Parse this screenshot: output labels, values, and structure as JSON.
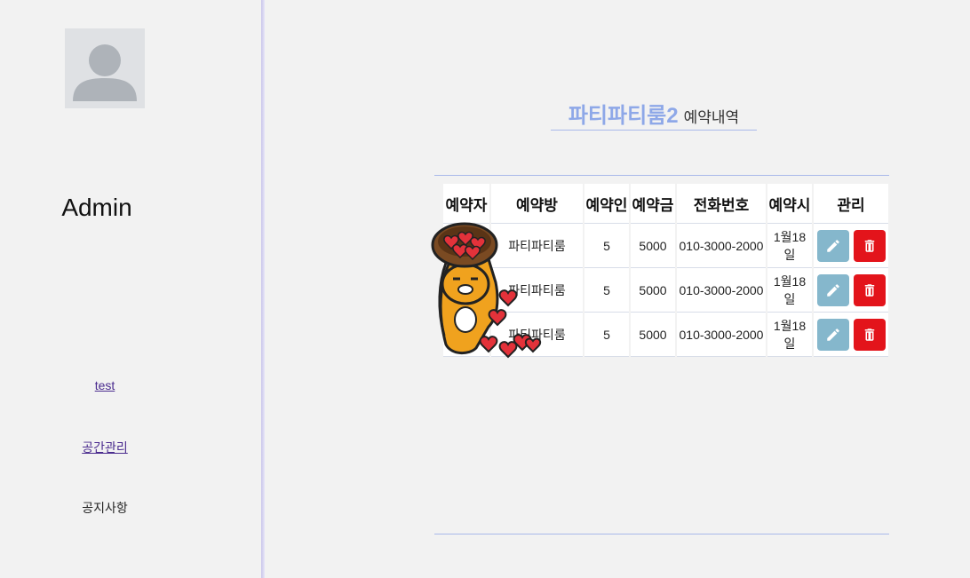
{
  "sidebar": {
    "admin_name": "Admin",
    "links": [
      {
        "label": "test"
      },
      {
        "label": "공간관리"
      },
      {
        "label": "공지사항"
      }
    ]
  },
  "header": {
    "room_name": "파티파티룸2",
    "subtitle": "예약내역"
  },
  "table": {
    "headers": [
      "예약자",
      "예약방",
      "예약인",
      "예약금",
      "전화번호",
      "예약시",
      "관리"
    ],
    "rows": [
      {
        "room": "파티파티룸",
        "people": "5",
        "deposit": "5000",
        "phone": "010-3000-2000",
        "date_line1": "1월18",
        "date_line2": "일"
      },
      {
        "room": "파티파티룸",
        "people": "5",
        "deposit": "5000",
        "phone": "010-3000-2000",
        "date_line1": "1월18",
        "date_line2": "일"
      },
      {
        "room": "파티파티룸",
        "people": "5",
        "deposit": "5000",
        "phone": "010-3000-2000",
        "date_line1": "1월18",
        "date_line2": "일"
      }
    ]
  },
  "icons": {
    "avatar": "user-placeholder-icon",
    "edit": "pencil-icon",
    "delete": "trash-icon"
  },
  "colors": {
    "accent": "#8ea8e8",
    "edit_button": "#85b7cc",
    "delete_button": "#e3141b",
    "link": "#4b2c8f"
  }
}
